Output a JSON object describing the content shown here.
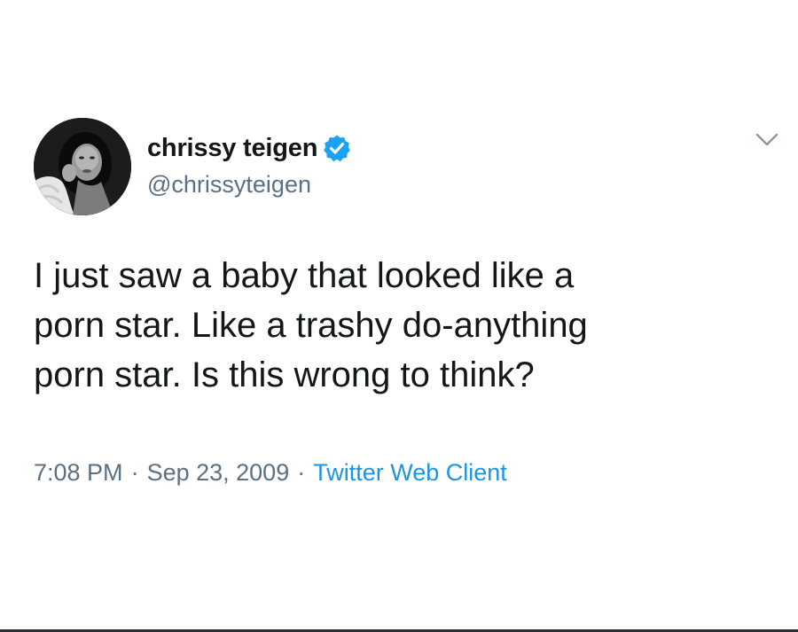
{
  "tweet": {
    "author": {
      "display_name": "chrissy teigen",
      "handle": "@chrissyteigen",
      "verified": true,
      "avatar_icon": "profile-photo"
    },
    "text_lines": [
      "I just saw a baby that looked like a",
      "porn star. Like a trashy do-anything",
      "porn star. Is this wrong to think?"
    ],
    "meta": {
      "time": "7:08 PM",
      "separator": "·",
      "date": "Sep 23, 2009",
      "source": "Twitter Web Client"
    },
    "menu_icon": "chevron-down-icon"
  },
  "colors": {
    "text": "#14171a",
    "secondary_text": "#5b7083",
    "link_blue": "#1b95e0",
    "verified_blue": "#1da1f2",
    "background": "#ffffff"
  }
}
